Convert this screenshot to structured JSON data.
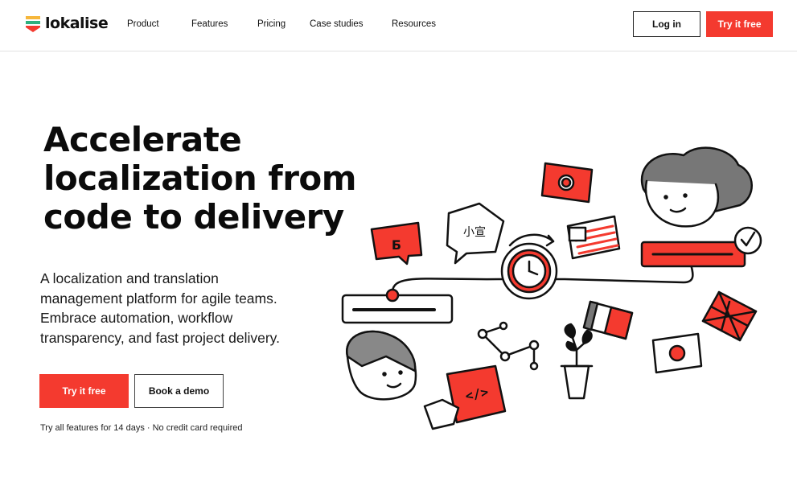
{
  "header": {
    "logo_text": "lokalise",
    "nav": [
      {
        "label": "Product"
      },
      {
        "label": "Features"
      },
      {
        "label": "Pricing"
      },
      {
        "label": "Case studies"
      },
      {
        "label": "Resources"
      }
    ],
    "login_label": "Log in",
    "try_label": "Try it free"
  },
  "hero": {
    "title_lines": [
      "Accelerate",
      "localization from",
      "code to delivery"
    ],
    "subtitle_lines": [
      "A localization and translation",
      "management platform for agile teams.",
      "Embrace automation, workflow",
      "transparency, and fast project delivery."
    ],
    "try_label": "Try it free",
    "demo_label": "Book a demo",
    "note": "Try all features for 14 days · No credit card required"
  },
  "illustration": {
    "glyph_cyrillic": "Б",
    "glyph_chinese": "小宣",
    "code_symbol": "</>"
  },
  "colors": {
    "accent": "#f43a2f",
    "text": "#111111",
    "border": "#e3e3e3"
  }
}
